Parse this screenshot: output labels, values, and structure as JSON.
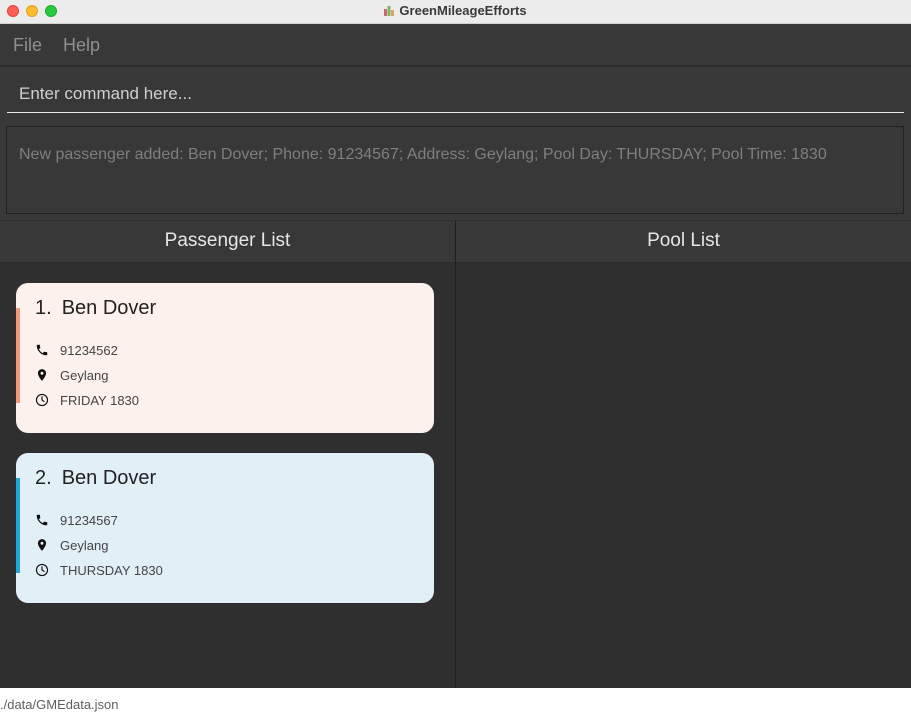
{
  "window": {
    "title": "GreenMileageEfforts"
  },
  "menu": {
    "file": "File",
    "help": "Help"
  },
  "command": {
    "placeholder": "Enter command here..."
  },
  "result": {
    "text": "New passenger added: Ben Dover; Phone: 91234567; Address: Geylang; Pool Day: THURSDAY; Pool Time: 1830"
  },
  "panels": {
    "passenger_title": "Passenger List",
    "pool_title": "Pool List"
  },
  "passengers": [
    {
      "index": "1.",
      "name": "Ben Dover",
      "phone": "91234562",
      "address": "Geylang",
      "time": "FRIDAY 1830",
      "accent": "#f09a7a",
      "background": "#fdf1ee"
    },
    {
      "index": "2.",
      "name": "Ben Dover",
      "phone": "91234567",
      "address": "Geylang",
      "time": "THURSDAY 1830",
      "accent": "#1fa8d8",
      "background": "#e1eff7"
    }
  ],
  "icons": {
    "phone": "phone-icon",
    "address": "map-pin-icon",
    "time": "clock-icon"
  },
  "status": {
    "path": "./data/GMEdata.json"
  }
}
